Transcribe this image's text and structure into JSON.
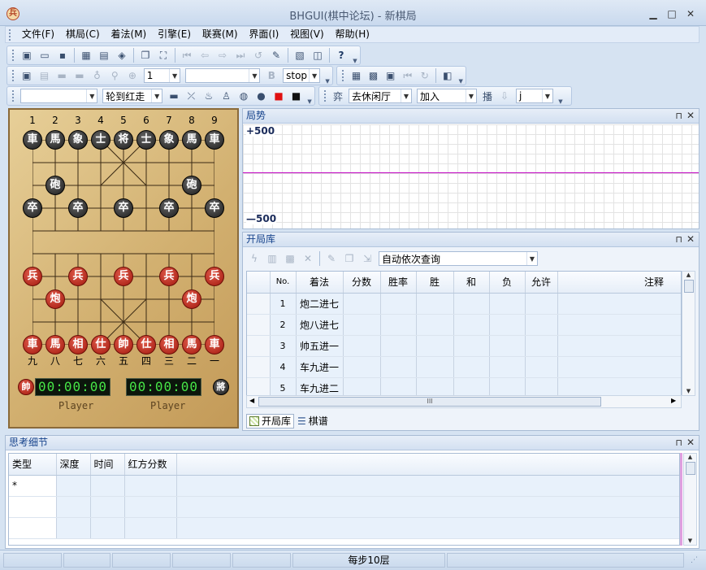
{
  "window": {
    "title": "BHGUI(棋中论坛) - 新棋局",
    "app_icon": "兵",
    "minimize": "▁",
    "maximize": "□",
    "close": "✕"
  },
  "menu": [
    "文件(F)",
    "棋局(C)",
    "着法(M)",
    "引擎(E)",
    "联赛(M)",
    "界面(I)",
    "视图(V)",
    "帮助(H)"
  ],
  "toolbar2": {
    "depth_value": "1",
    "b_label": "B",
    "stop_value": "stop"
  },
  "toolbar3": {
    "turn_value": "轮到红走",
    "yi_label": "弈",
    "room_value": "去休闲厅",
    "join_value": "加入",
    "bo_label": "播",
    "j_value": "j"
  },
  "board": {
    "top_coords": [
      "1",
      "2",
      "3",
      "4",
      "5",
      "6",
      "7",
      "8",
      "9"
    ],
    "bottom_coords": [
      "九",
      "八",
      "七",
      "六",
      "五",
      "四",
      "三",
      "二",
      "一"
    ],
    "black_back_rank": [
      "車",
      "馬",
      "象",
      "士",
      "将",
      "士",
      "象",
      "馬",
      "車"
    ],
    "black_cannon": "砲",
    "black_pawn": "卒",
    "red_back_rank": [
      "車",
      "馬",
      "相",
      "仕",
      "帥",
      "仕",
      "相",
      "馬",
      "車"
    ],
    "red_cannon": "炮",
    "red_pawn": "兵",
    "red_clock_label": "帥",
    "black_clock_label": "將",
    "red_clock": "00:00:00",
    "black_clock": "00:00:00",
    "red_player": "Player",
    "black_player": "Player"
  },
  "eval_panel": {
    "title": "局势",
    "top_label": "+500",
    "bottom_label": "—500",
    "line_color": "#c000c0"
  },
  "opening_panel": {
    "title": "开局库",
    "query_mode": "自动依次查询",
    "columns": [
      "No.",
      "着法",
      "分数",
      "胜率",
      "胜",
      "和",
      "负",
      "允许",
      "注释"
    ],
    "rows": [
      {
        "no": "1",
        "move": "炮二进七"
      },
      {
        "no": "2",
        "move": "炮八进七"
      },
      {
        "no": "3",
        "move": "帅五进一"
      },
      {
        "no": "4",
        "move": "车九进一"
      },
      {
        "no": "5",
        "move": "车九进二"
      }
    ],
    "scroll_label": "III",
    "tabs": [
      "开局库",
      "棋谱"
    ]
  },
  "thinking_panel": {
    "title": "思考细节",
    "columns": [
      "类型",
      "深度",
      "时间",
      "红方分数"
    ],
    "first_cell": "*"
  },
  "statusbar": {
    "text": "每步10层"
  }
}
